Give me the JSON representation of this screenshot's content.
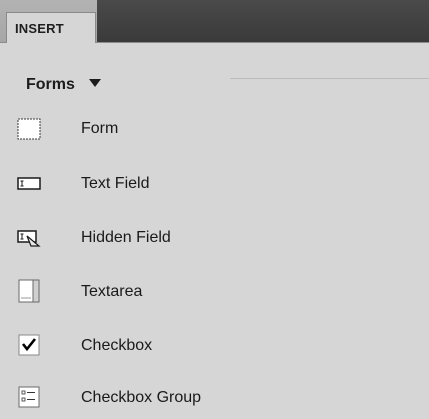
{
  "panel": {
    "tab_label": "INSERT"
  },
  "category": {
    "label": "Forms"
  },
  "items": [
    {
      "label": "Form",
      "icon": "form-icon"
    },
    {
      "label": "Text Field",
      "icon": "text-field-icon"
    },
    {
      "label": "Hidden Field",
      "icon": "hidden-field-icon"
    },
    {
      "label": "Textarea",
      "icon": "textarea-icon"
    },
    {
      "label": "Checkbox",
      "icon": "checkbox-icon"
    },
    {
      "label": "Checkbox Group",
      "icon": "checkbox-group-icon"
    }
  ]
}
